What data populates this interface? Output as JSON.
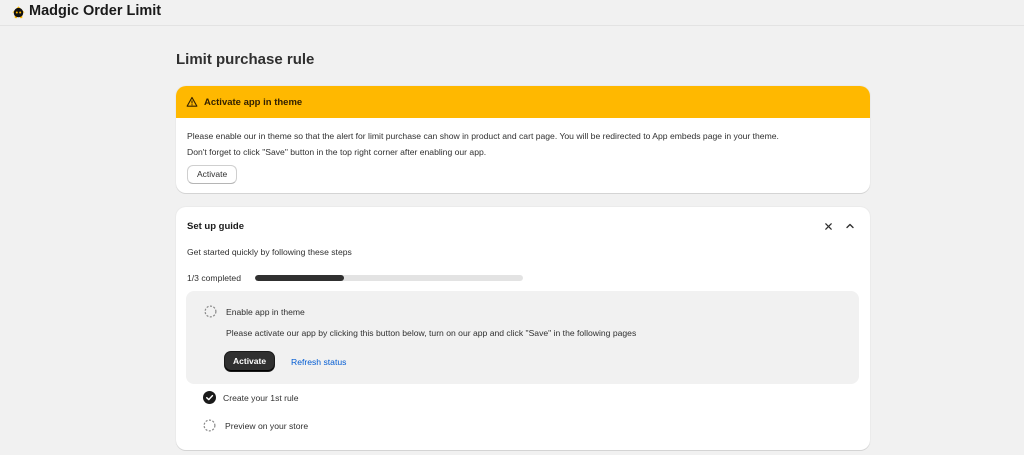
{
  "app": {
    "title": "Madgic Order Limit",
    "logo_icon": "app-logo-icon"
  },
  "page": {
    "title": "Limit purchase rule"
  },
  "banner": {
    "title": "Activate app in theme",
    "icon": "warning-icon",
    "color": "#ffb800",
    "line1": "Please enable our in theme so that the alert for limit purchase can show in product and cart page. You will be redirected to App embeds page in your theme.",
    "line2": "Don't forget to click \"Save\" button in the top right corner after enabling our app.",
    "button_label": "Activate"
  },
  "guide": {
    "title": "Set up guide",
    "subtitle": "Get started quickly by following these steps",
    "progress_label": "1/3 completed",
    "progress_fraction": 0.333,
    "close_icon": "close-icon",
    "collapse_icon": "chevron-up-icon",
    "steps": [
      {
        "title": "Enable app in theme",
        "completed": false,
        "description": "Please activate our app by clicking this button below, turn on our app and click \"Save\" in the following pages",
        "primary_label": "Activate",
        "link_label": "Refresh status"
      },
      {
        "title": "Create your 1st rule",
        "completed": true
      },
      {
        "title": "Preview on your store",
        "completed": false
      }
    ]
  }
}
